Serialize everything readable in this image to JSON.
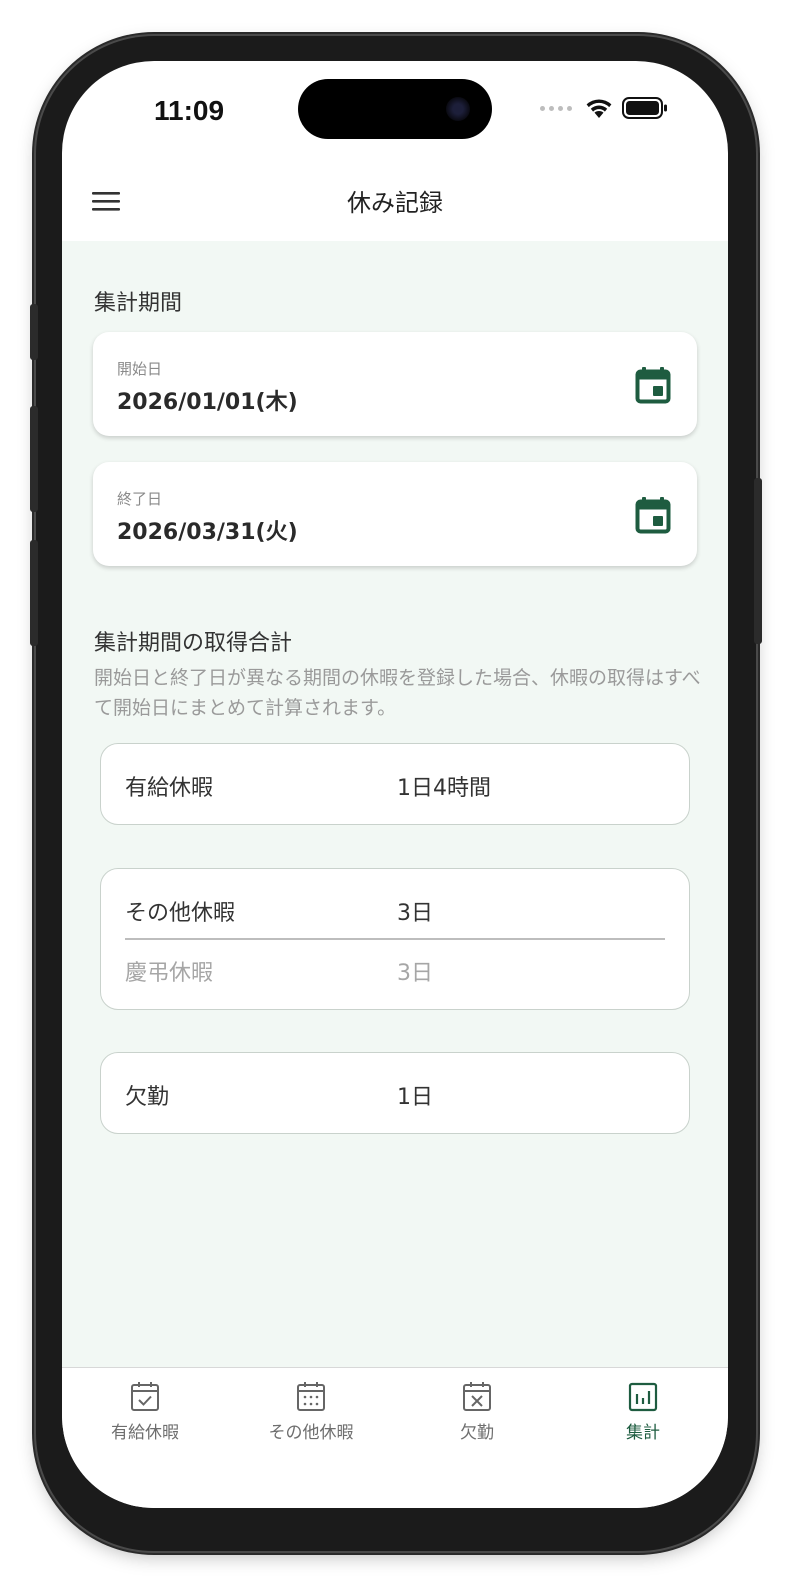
{
  "status_bar": {
    "time": "11:09"
  },
  "app_bar": {
    "title": "休み記録",
    "menu_icon": "hamburger-menu-icon"
  },
  "period": {
    "section_label": "集計期間",
    "start": {
      "label": "開始日",
      "value": "2026/01/01(木)",
      "icon": "calendar-icon"
    },
    "end": {
      "label": "終了日",
      "value": "2026/03/31(火)",
      "icon": "calendar-icon"
    }
  },
  "totals": {
    "section_label": "集計期間の取得合計",
    "description": "開始日と終了日が異なる期間の休暇を登録した場合、休暇の取得はすべて開始日にまとめて計算されます。",
    "paid": {
      "name": "有給休暇",
      "amount": "1日4時間"
    },
    "other": {
      "name": "その他休暇",
      "amount": "3日",
      "breakdown": [
        {
          "name": "慶弔休暇",
          "amount": "3日"
        }
      ]
    },
    "absence": {
      "name": "欠勤",
      "amount": "1日"
    }
  },
  "bottom_nav": {
    "items": [
      {
        "label": "有給休暇",
        "icon": "calendar-check-icon"
      },
      {
        "label": "その他休暇",
        "icon": "calendar-grid-icon"
      },
      {
        "label": "欠勤",
        "icon": "calendar-x-icon"
      },
      {
        "label": "集計",
        "icon": "bar-chart-icon"
      }
    ],
    "active_index": 3
  },
  "colors": {
    "accent": "#1e5c40",
    "content_background": "#f2f8f4",
    "muted_text": "#9a9a9a"
  }
}
